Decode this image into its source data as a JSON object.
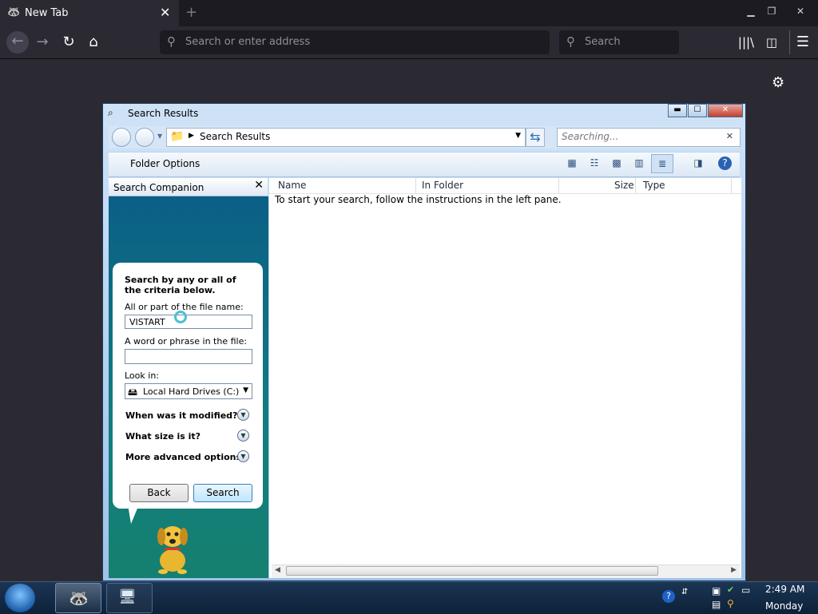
{
  "browser": {
    "tab_title": "New Tab",
    "tab_close": "✕",
    "new_tab": "+",
    "url_placeholder": "Search or enter address",
    "search_placeholder": "Search"
  },
  "window": {
    "title": "Search Results",
    "breadcrumb": "Search Results",
    "search_placeholder": "Searching...",
    "toolbar_label": "Folder Options"
  },
  "left_pane": {
    "header": "Search Companion",
    "heading": "Search by any or all of the criteria below.",
    "filename_label": "All or part of the file name:",
    "filename_value": "VISTART",
    "phrase_label": "A word or phrase in the file:",
    "phrase_value": "",
    "lookin_label": "Look in:",
    "lookin_value": "Local Hard Drives (C:)",
    "options": [
      {
        "label": "When was it modified?"
      },
      {
        "label": "What size is it?"
      },
      {
        "label": "More advanced options"
      }
    ],
    "back_button": "Back",
    "search_button": "Search"
  },
  "results": {
    "columns": [
      "Name",
      "In Folder",
      "Size",
      "Type"
    ],
    "empty_message": "To start your search, follow the instructions in the left pane."
  },
  "taskbar": {
    "time": "2:49 AM",
    "day": "Monday"
  },
  "colors": {
    "browser_bg": "#2b2a33",
    "companion_bg": "#0a5f86",
    "taskbar": "#1b3553"
  }
}
